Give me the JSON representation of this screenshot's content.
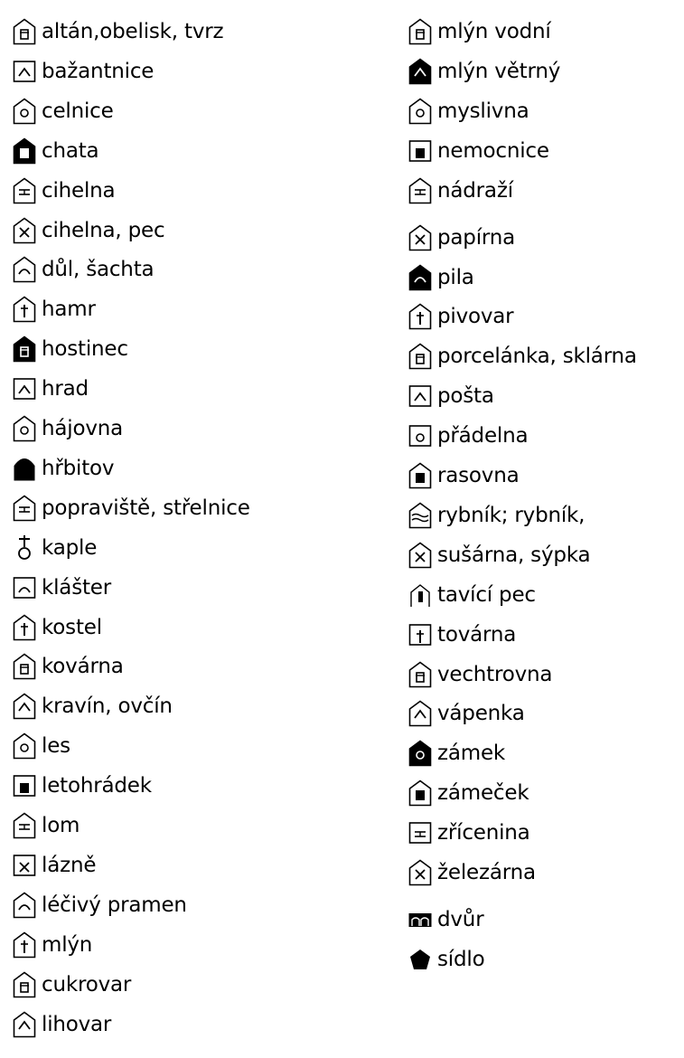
{
  "colors": {
    "ink": "#000000",
    "paper": "#ffffff"
  },
  "legend": {
    "left": [
      {
        "label": "altán,obelisk, tvrz",
        "icon": "house-arch-icon"
      },
      {
        "label": "bažantnice",
        "icon": "bird-icon"
      },
      {
        "label": "celnice",
        "icon": "customs-figure-icon"
      },
      {
        "label": "chata",
        "icon": "cottage-icon"
      },
      {
        "label": "cihelna",
        "icon": "brickworks-icon"
      },
      {
        "label": "cihelna, pec",
        "icon": "brick-kiln-icon"
      },
      {
        "label": "důl, šachta",
        "icon": "mine-hammers-icon"
      },
      {
        "label": "hamr",
        "icon": "hammer-mill-icon"
      },
      {
        "label": "hostinec",
        "icon": "inn-icon"
      },
      {
        "label": "hrad",
        "icon": "castle-icon"
      },
      {
        "label": "hájovna",
        "icon": "gamekeeper-trees-icon"
      },
      {
        "label": "hřbitov",
        "icon": "cemetery-icon"
      },
      {
        "label": "popraviště, střelnice",
        "icon": "target-icon"
      },
      {
        "label": "kaple",
        "icon": "chapel-cross-icon"
      },
      {
        "label": "klášter",
        "icon": "monastery-icon"
      },
      {
        "label": "kostel",
        "icon": "church-icon"
      },
      {
        "label": "kovárna",
        "icon": "smithy-icon"
      },
      {
        "label": "kravín, ovčín",
        "icon": "cowshed-icon"
      },
      {
        "label": "les",
        "icon": "forest-tree-icon"
      },
      {
        "label": "letohrádek",
        "icon": "summer-palace-icon"
      },
      {
        "label": "lom",
        "icon": "quarry-icon"
      },
      {
        "label": "lázně",
        "icon": "spa-icon"
      },
      {
        "label": "léčivý pramen",
        "icon": "healing-spring-icon"
      },
      {
        "label": "mlýn",
        "icon": "mill-wheel-icon"
      },
      {
        "label": "cukrovar",
        "icon": "sugar-factory-icon"
      },
      {
        "label": "lihovar",
        "icon": "distillery-icon"
      }
    ],
    "right": [
      {
        "label": "mlýn vodní",
        "icon": "water-mill-icon"
      },
      {
        "label": "mlýn větrný",
        "icon": "windmill-icon"
      },
      {
        "label": "myslivna",
        "icon": "hunting-lodge-icon"
      },
      {
        "label": "nemocnice",
        "icon": "hospital-cross-icon"
      },
      {
        "label": "nádraží",
        "icon": "railway-station-icon"
      },
      {
        "label": "papírna",
        "icon": "paper-mill-icon"
      },
      {
        "label": "pila",
        "icon": "sawmill-icon"
      },
      {
        "label": "pivovar",
        "icon": "brewery-icon"
      },
      {
        "label": "porcelánka, sklárna",
        "icon": "porcelain-glass-icon"
      },
      {
        "label": "pošta",
        "icon": "post-envelope-icon"
      },
      {
        "label": "přádelna",
        "icon": "spinning-mill-icon"
      },
      {
        "label": "rasovna",
        "icon": "knackery-icon"
      },
      {
        "label": "rybník; rybník,",
        "icon": "pond-waves-icon"
      },
      {
        "label": "sušárna, sýpka",
        "icon": "granary-icon"
      },
      {
        "label": "tavící pec",
        "icon": "smelting-furnace-icon"
      },
      {
        "label": "továrna",
        "icon": "factory-icon"
      },
      {
        "label": "vechtrovna",
        "icon": "watchman-house-icon"
      },
      {
        "label": "vápenka",
        "icon": "lime-kiln-icon"
      },
      {
        "label": "zámek",
        "icon": "chateau-icon"
      },
      {
        "label": "zámeček",
        "icon": "small-chateau-icon"
      },
      {
        "label": "zřícenina",
        "icon": "ruin-icon"
      },
      {
        "label": "železárna",
        "icon": "ironworks-icon"
      },
      {
        "label": "dvůr",
        "icon": "farmyard-icon"
      },
      {
        "label": "sídlo",
        "icon": "settlement-pentagon-icon"
      }
    ]
  }
}
